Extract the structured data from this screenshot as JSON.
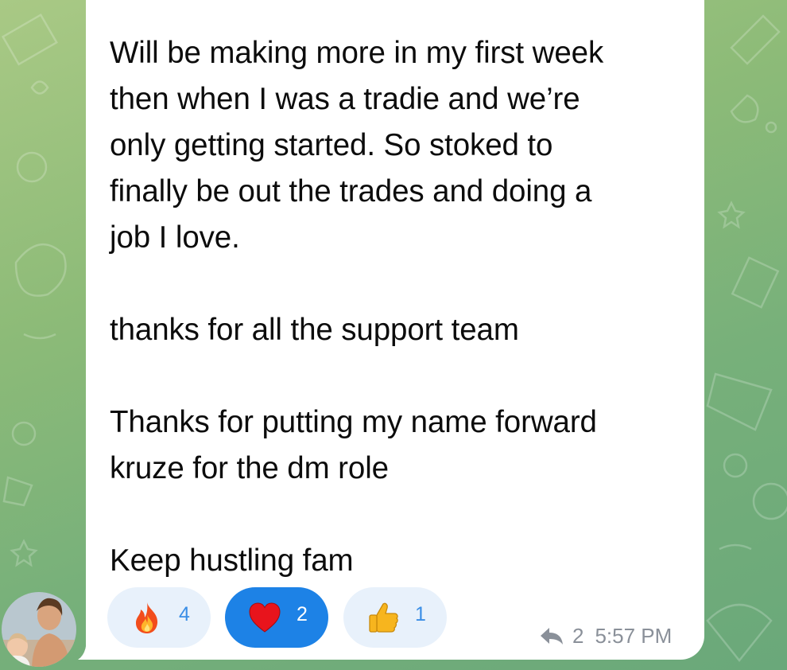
{
  "message": {
    "paragraphs": [
      "Will be making more in my first week then when I was a tradie and we’re only getting started. So stoked to finally be out the trades and doing a job I love.",
      "thanks for all the support team",
      "Thanks for putting my name forward kruze for the dm role",
      "Keep hustling fam"
    ],
    "lines": [
      "Will be making more in my first week",
      "then when I was a tradie and we’re",
      "only getting started. So stoked to",
      "finally be out the trades and doing a",
      "job I love.",
      "",
      "thanks for all the support team",
      "",
      "Thanks for putting my name forward",
      "kruze for the dm role",
      "",
      "Keep hustling fam"
    ]
  },
  "reactions": [
    {
      "emoji": "fire-icon",
      "count": "4",
      "selected": false
    },
    {
      "emoji": "heart-icon",
      "count": "2",
      "selected": true
    },
    {
      "emoji": "thumbs-up-icon",
      "count": "1",
      "selected": false
    }
  ],
  "meta": {
    "reply_icon": "reply-arrow-icon",
    "reply_count": "2",
    "time": "5:57 PM"
  },
  "colors": {
    "bubble": "#ffffff",
    "reaction_bg": "#e8f1fb",
    "reaction_selected": "#1d82e6",
    "meta_text": "#8a9099"
  }
}
